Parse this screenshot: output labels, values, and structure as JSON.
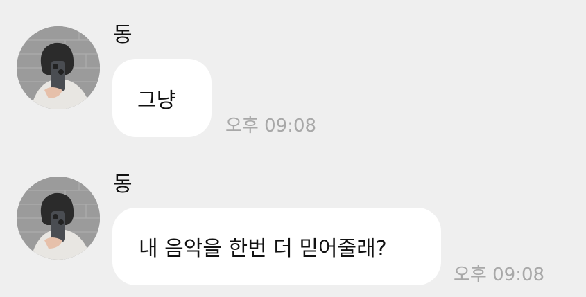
{
  "messages": [
    {
      "sender": "동",
      "text": "그냥",
      "time": "오후 09:08"
    },
    {
      "sender": "동",
      "text": "내 음악을 한번 더 믿어줄래?",
      "time": "오후 09:08"
    }
  ],
  "colors": {
    "background": "#efefef",
    "bubble": "#ffffff",
    "text": "#111111",
    "timestamp": "#a8a8a8"
  }
}
